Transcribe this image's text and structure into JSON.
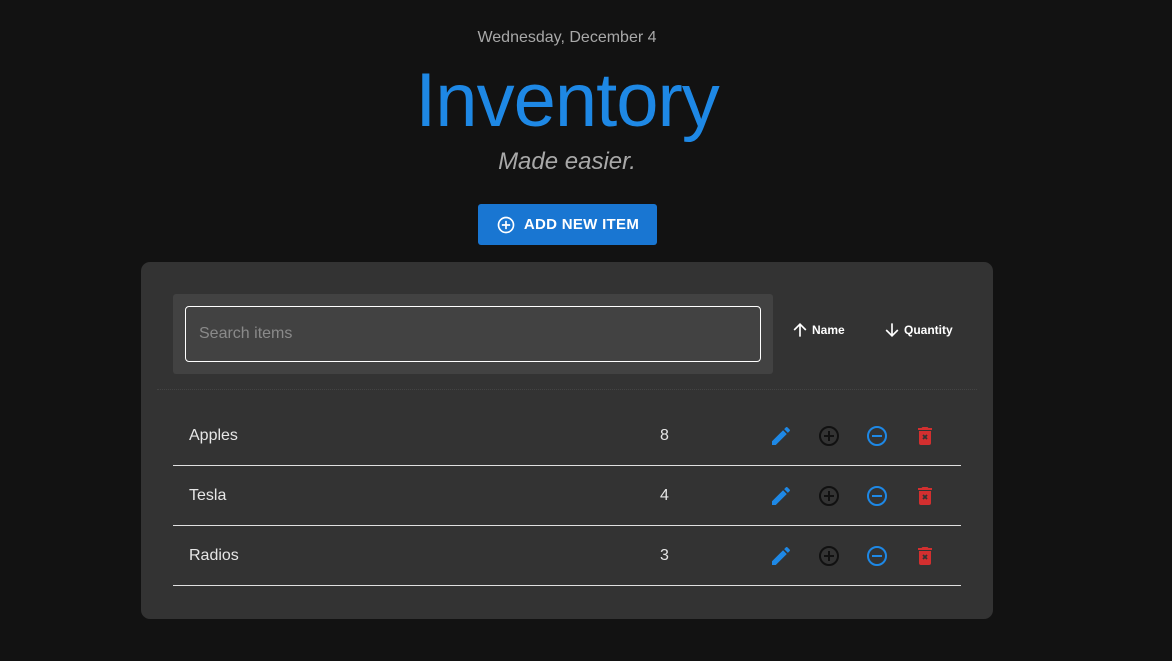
{
  "header": {
    "date": "Wednesday, December 4",
    "title": "Inventory",
    "subtitle": "Made easier."
  },
  "add_button": {
    "label": "ADD NEW ITEM",
    "icon": "add-circle-outline-icon"
  },
  "search": {
    "placeholder": "Search items",
    "value": ""
  },
  "sort": {
    "name": {
      "label": "Name",
      "icon": "arrow-up-icon"
    },
    "quantity": {
      "label": "Quantity",
      "icon": "arrow-down-icon"
    }
  },
  "items": [
    {
      "name": "Apples",
      "quantity": "8"
    },
    {
      "name": "Tesla",
      "quantity": "4"
    },
    {
      "name": "Radios",
      "quantity": "3"
    }
  ],
  "actions": [
    "edit-icon",
    "add-circle-outline-icon",
    "remove-circle-outline-icon",
    "delete-forever-icon"
  ],
  "colors": {
    "accent": "#1e88e5",
    "button": "#1976d2",
    "delete": "#d32f2f",
    "increment": "#111111",
    "background": "#121212",
    "panel": "#333333"
  }
}
